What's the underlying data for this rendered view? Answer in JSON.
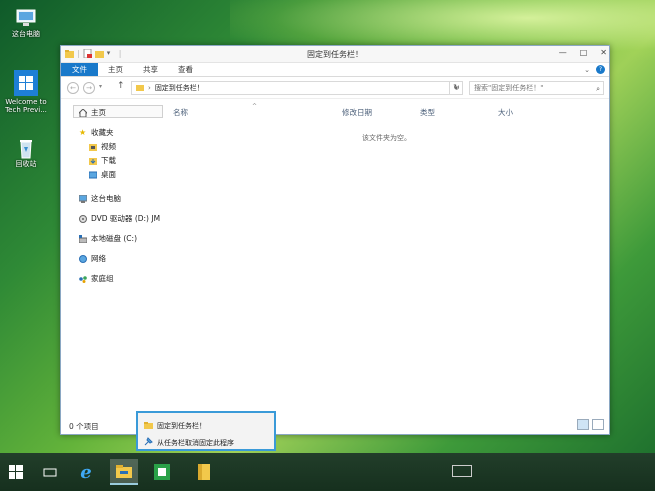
{
  "desktop": {
    "icons": [
      {
        "label": "这台电脑",
        "icon": "computer-icon"
      },
      {
        "label": "Welcome to Tech Previ...",
        "icon": "windows-logo-icon"
      },
      {
        "label": "回收站",
        "icon": "recycle-bin-icon"
      }
    ]
  },
  "window": {
    "title": "固定到任务栏！",
    "qat_separator": "|",
    "ribbon_tabs": [
      "文件",
      "主页",
      "共享",
      "查看"
    ],
    "address_path": "固定到任务栏！",
    "search_placeholder": "搜索\"固定到任务栏！\"",
    "nav": {
      "home": "主页",
      "favorites": "收藏夹",
      "favorites_children": [
        "视频",
        "下载",
        "桌面"
      ],
      "this_pc": "这台电脑",
      "dvd": "DVD 驱动器 (D:) JM",
      "local_disk": "本地磁盘 (C:)",
      "network": "网络",
      "homegroup": "家庭组"
    },
    "columns": [
      "名称",
      "修改日期",
      "类型",
      "大小"
    ],
    "empty_message": "该文件夹为空。",
    "status_count": "0 个项目"
  },
  "jump_list": {
    "items": [
      {
        "label": "固定到任务栏！",
        "icon": "folder-icon"
      },
      {
        "label": "从任务栏取消固定此程序",
        "icon": "unpin-icon"
      }
    ]
  },
  "taskbar": {
    "items": [
      "start",
      "task-view",
      "internet-explorer",
      "file-explorer",
      "store",
      "pinned-folder"
    ]
  },
  "colors": {
    "accent": "#1979ca",
    "jump_border": "#3a9ad8",
    "taskbar": "#1c3a24"
  }
}
